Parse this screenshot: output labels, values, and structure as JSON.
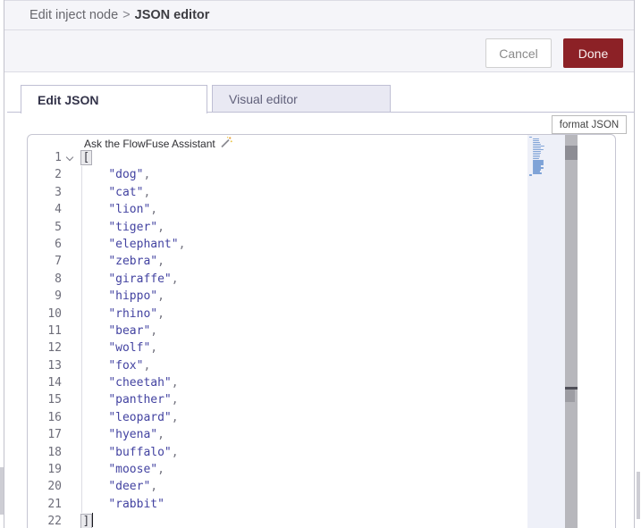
{
  "breadcrumb": {
    "parent": "Edit inject node",
    "separator": ">",
    "current": "JSON editor"
  },
  "header_actions": {
    "cancel_label": "Cancel",
    "done_label": "Done"
  },
  "tabs": {
    "edit_json_label": "Edit JSON",
    "visual_editor_label": "Visual editor"
  },
  "toolbar": {
    "format_json_label": "format JSON"
  },
  "editor": {
    "assistant_hint": "Ask the FlowFuse Assistant",
    "language": "json",
    "indent_spaces": 4,
    "lines": [
      {
        "num": 1,
        "kind": "open",
        "bracket": "["
      },
      {
        "num": 2,
        "kind": "string",
        "value": "dog",
        "comma": true
      },
      {
        "num": 3,
        "kind": "string",
        "value": "cat",
        "comma": true
      },
      {
        "num": 4,
        "kind": "string",
        "value": "lion",
        "comma": true
      },
      {
        "num": 5,
        "kind": "string",
        "value": "tiger",
        "comma": true
      },
      {
        "num": 6,
        "kind": "string",
        "value": "elephant",
        "comma": true
      },
      {
        "num": 7,
        "kind": "string",
        "value": "zebra",
        "comma": true
      },
      {
        "num": 8,
        "kind": "string",
        "value": "giraffe",
        "comma": true
      },
      {
        "num": 9,
        "kind": "string",
        "value": "hippo",
        "comma": true
      },
      {
        "num": 10,
        "kind": "string",
        "value": "rhino",
        "comma": true
      },
      {
        "num": 11,
        "kind": "string",
        "value": "bear",
        "comma": true
      },
      {
        "num": 12,
        "kind": "string",
        "value": "wolf",
        "comma": true
      },
      {
        "num": 13,
        "kind": "string",
        "value": "fox",
        "comma": true
      },
      {
        "num": 14,
        "kind": "string",
        "value": "cheetah",
        "comma": true
      },
      {
        "num": 15,
        "kind": "string",
        "value": "panther",
        "comma": true
      },
      {
        "num": 16,
        "kind": "string",
        "value": "leopard",
        "comma": true
      },
      {
        "num": 17,
        "kind": "string",
        "value": "hyena",
        "comma": true
      },
      {
        "num": 18,
        "kind": "string",
        "value": "buffalo",
        "comma": true
      },
      {
        "num": 19,
        "kind": "string",
        "value": "moose",
        "comma": true
      },
      {
        "num": 20,
        "kind": "string",
        "value": "deer",
        "comma": true
      },
      {
        "num": 21,
        "kind": "string",
        "value": "rabbit",
        "comma": false
      },
      {
        "num": 22,
        "kind": "close",
        "bracket": "]",
        "cursor": true
      }
    ]
  },
  "icons": {
    "fold_chevron": "chevron-down-icon",
    "assistant_wand": "magic-wand-icon"
  },
  "colors": {
    "done_button": "#8c2126",
    "string": "#4343a1",
    "line_number": "#6d6d79",
    "minimap_mark": "#7fa3d7",
    "tab_inactive_bg": "#e9e9f3",
    "header_bg": "#f5f5f9"
  }
}
